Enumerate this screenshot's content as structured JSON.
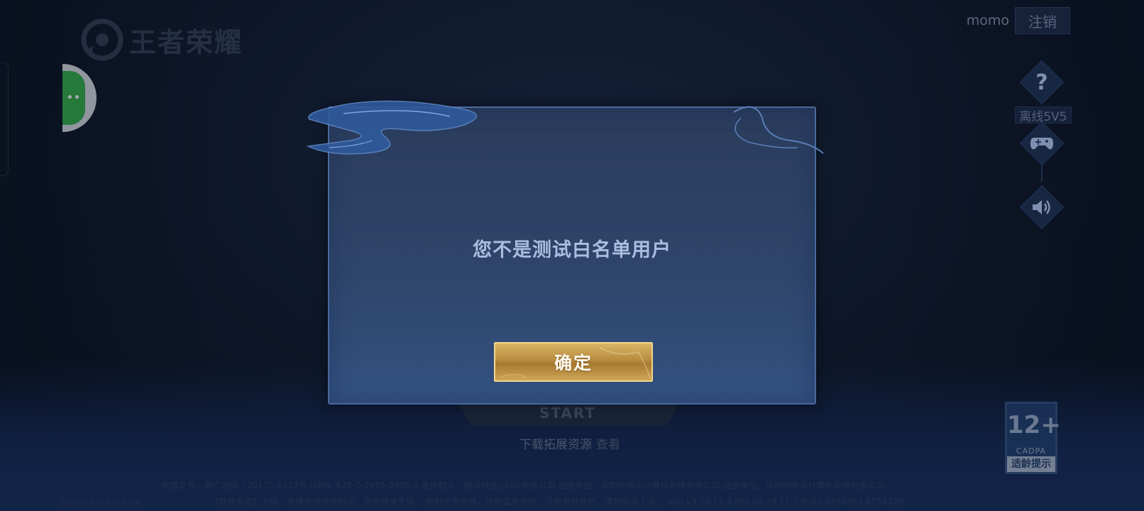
{
  "logo": {
    "text": "王者荣耀"
  },
  "account": {
    "username": "momo",
    "logout_label": "注销"
  },
  "side_buttons": {
    "help_glyph": "?",
    "offline_label": "离线5V5",
    "gamepad_icon": "gamepad-icon",
    "sound_icon": "speaker-icon"
  },
  "age_rating": {
    "age": "12+",
    "org": "CADPA",
    "tip": "适龄提示"
  },
  "background": {
    "start_text": "START",
    "download_label": "下载拓展资源",
    "download_view": "查看"
  },
  "footer": {
    "line1": "批准文号：新广出审〔2017〕6712号  ISBN: 978-7-7979-8408-9  著作权人：腾讯科技(深圳)有限公司  出版单位：深圳市腾讯计算机系统有限公司  运营单位：深圳市腾讯计算机系统有限公司",
    "line2": "【就装系统】上线，合理安排游戏时间，享受健康生活。 抵制不良游戏，拒绝盗版游戏。注意自我保护，谨防受骗上当。 App v9.29.11.4  Res v9.29.11.2  Build 8154563  8154320",
    "version_left": "Quests ESI Res Type"
  },
  "dialog": {
    "message": "您不是测试白名单用户",
    "confirm_label": "确定"
  },
  "colors": {
    "background": "#101b2e",
    "dialog": "#2e4468",
    "dialog_border": "#4a6a9d",
    "confirm_gold": "#b98c3f",
    "assistant_green": "#33b24c"
  }
}
